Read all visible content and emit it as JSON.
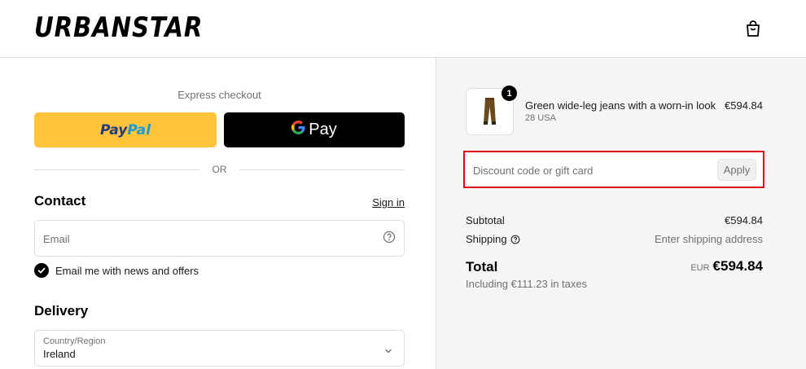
{
  "header": {
    "logo": "URBANSTAR",
    "cart_icon": "shopping-bag-icon"
  },
  "express": {
    "label": "Express checkout",
    "paypal_pay": "Pay",
    "paypal_pal": "Pal",
    "gpay_label": "Pay",
    "or_label": "OR"
  },
  "contact": {
    "title": "Contact",
    "signin_label": "Sign in",
    "email_placeholder": "Email",
    "newsletter_label": "Email me with news and offers",
    "newsletter_checked": true
  },
  "delivery": {
    "title": "Delivery",
    "country_caption": "Country/Region",
    "country_value": "Ireland"
  },
  "order": {
    "item_name": "Green wide-leg jeans with a worn-in look",
    "item_variant": "28 USA",
    "item_price": "€594.84",
    "item_quantity": "1",
    "discount_placeholder": "Discount code or gift card",
    "apply_label": "Apply",
    "subtotal_label": "Subtotal",
    "subtotal_value": "€594.84",
    "shipping_label": "Shipping",
    "shipping_value": "Enter shipping address",
    "total_label": "Total",
    "total_currency": "EUR",
    "total_value": "€594.84",
    "tax_note": "Including €111.23 in taxes"
  },
  "colors": {
    "paypal_yellow": "#ffc439",
    "gpay_black": "#000000",
    "highlight_red": "#e0001a",
    "summary_bg": "#f5f5f5"
  }
}
